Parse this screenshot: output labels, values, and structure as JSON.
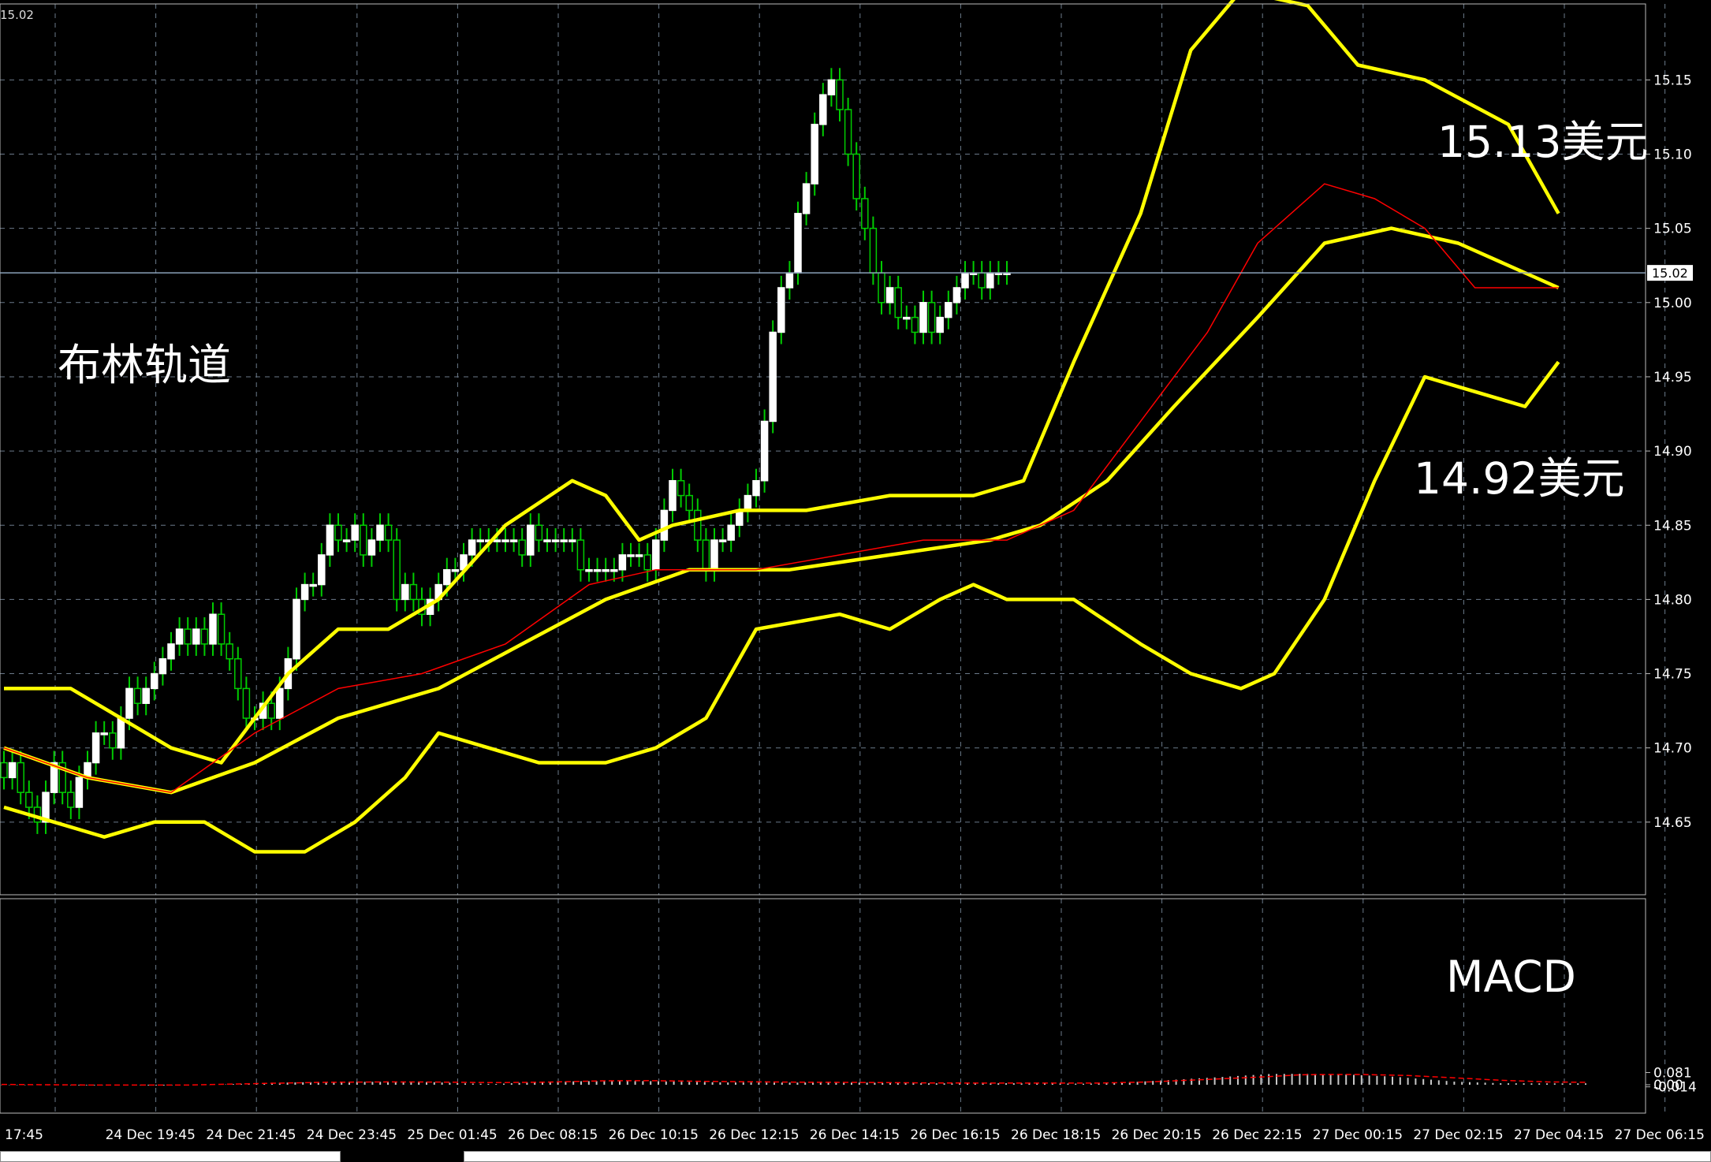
{
  "chart_data": [
    {
      "type": "candlestick",
      "price_readout_top_left": "15.02",
      "last_price": "15.02",
      "ylim": [
        14.605,
        15.205
      ],
      "y_ticks": [
        "15.15",
        "15.10",
        "15.05",
        "15.00",
        "14.95",
        "14.90",
        "14.85",
        "14.80",
        "14.75",
        "14.70",
        "14.65"
      ],
      "x_ticks": [
        "17:45",
        "24 Dec 19:45",
        "24 Dec 21:45",
        "24 Dec 23:45",
        "25 Dec 01:45",
        "26 Dec 08:15",
        "26 Dec 10:15",
        "26 Dec 12:15",
        "26 Dec 14:15",
        "26 Dec 16:15",
        "26 Dec 18:15",
        "26 Dec 20:15",
        "26 Dec 22:15",
        "27 Dec 00:15",
        "27 Dec 02:15",
        "27 Dec 04:15",
        "27 Dec 06:15"
      ],
      "annotations": [
        "布林轨道",
        "15.13美元",
        "14.92美元"
      ],
      "indicator": "Bollinger Bands",
      "colors": {
        "background": "#000000",
        "grid": "#6b7a8a",
        "candle_bull": "#ffffff",
        "wick": "#00cc00",
        "bands": "#ffff00",
        "signal": "#ff0000",
        "price_line": "#8aa0b8"
      },
      "bands": {
        "upper": [
          [
            0,
            14.74
          ],
          [
            8,
            14.74
          ],
          [
            20,
            14.7
          ],
          [
            26,
            14.69
          ],
          [
            30,
            14.72
          ],
          [
            34,
            14.75
          ],
          [
            40,
            14.78
          ],
          [
            46,
            14.78
          ],
          [
            52,
            14.8
          ],
          [
            60,
            14.85
          ],
          [
            68,
            14.88
          ],
          [
            72,
            14.87
          ],
          [
            76,
            14.84
          ],
          [
            80,
            14.85
          ],
          [
            88,
            14.86
          ],
          [
            96,
            14.86
          ],
          [
            106,
            14.87
          ],
          [
            116,
            14.87
          ],
          [
            122,
            14.88
          ],
          [
            128,
            14.96
          ],
          [
            136,
            15.06
          ],
          [
            142,
            15.17
          ],
          [
            148,
            15.21
          ],
          [
            156,
            15.2
          ],
          [
            162,
            15.16
          ],
          [
            170,
            15.15
          ],
          [
            180,
            15.12
          ],
          [
            186,
            15.06
          ]
        ],
        "middle": [
          [
            0,
            14.7
          ],
          [
            10,
            14.68
          ],
          [
            20,
            14.67
          ],
          [
            30,
            14.69
          ],
          [
            40,
            14.72
          ],
          [
            52,
            14.74
          ],
          [
            62,
            14.77
          ],
          [
            72,
            14.8
          ],
          [
            82,
            14.82
          ],
          [
            94,
            14.82
          ],
          [
            106,
            14.83
          ],
          [
            118,
            14.84
          ],
          [
            124,
            14.85
          ],
          [
            132,
            14.88
          ],
          [
            140,
            14.93
          ],
          [
            150,
            14.99
          ],
          [
            158,
            15.04
          ],
          [
            166,
            15.05
          ],
          [
            174,
            15.04
          ],
          [
            186,
            15.01
          ]
        ],
        "lower": [
          [
            0,
            14.66
          ],
          [
            6,
            14.65
          ],
          [
            12,
            14.64
          ],
          [
            18,
            14.65
          ],
          [
            24,
            14.65
          ],
          [
            30,
            14.63
          ],
          [
            36,
            14.63
          ],
          [
            42,
            14.65
          ],
          [
            48,
            14.68
          ],
          [
            52,
            14.71
          ],
          [
            58,
            14.7
          ],
          [
            64,
            14.69
          ],
          [
            72,
            14.69
          ],
          [
            78,
            14.7
          ],
          [
            84,
            14.72
          ],
          [
            90,
            14.78
          ],
          [
            100,
            14.79
          ],
          [
            106,
            14.78
          ],
          [
            112,
            14.8
          ],
          [
            116,
            14.81
          ],
          [
            120,
            14.8
          ],
          [
            128,
            14.8
          ],
          [
            136,
            14.77
          ],
          [
            142,
            14.75
          ],
          [
            148,
            14.74
          ],
          [
            152,
            14.75
          ],
          [
            158,
            14.8
          ],
          [
            164,
            14.88
          ],
          [
            170,
            14.95
          ],
          [
            176,
            14.94
          ],
          [
            182,
            14.93
          ],
          [
            186,
            14.96
          ]
        ]
      },
      "signal_ma": [
        [
          0,
          14.7
        ],
        [
          10,
          14.68
        ],
        [
          20,
          14.67
        ],
        [
          30,
          14.71
        ],
        [
          40,
          14.74
        ],
        [
          50,
          14.75
        ],
        [
          60,
          14.77
        ],
        [
          70,
          14.81
        ],
        [
          78,
          14.82
        ],
        [
          90,
          14.82
        ],
        [
          100,
          14.83
        ],
        [
          110,
          14.84
        ],
        [
          120,
          14.84
        ],
        [
          128,
          14.86
        ],
        [
          136,
          14.92
        ],
        [
          144,
          14.98
        ],
        [
          150,
          15.04
        ],
        [
          158,
          15.08
        ],
        [
          164,
          15.07
        ],
        [
          170,
          15.05
        ],
        [
          176,
          15.01
        ],
        [
          186,
          15.01
        ]
      ],
      "close": [
        14.68,
        14.69,
        14.67,
        14.66,
        14.65,
        14.67,
        14.69,
        14.67,
        14.66,
        14.68,
        14.69,
        14.71,
        14.71,
        14.7,
        14.72,
        14.74,
        14.73,
        14.74,
        14.75,
        14.76,
        14.77,
        14.78,
        14.77,
        14.78,
        14.77,
        14.79,
        14.77,
        14.76,
        14.74,
        14.72,
        14.72,
        14.73,
        14.72,
        14.74,
        14.76,
        14.8,
        14.81,
        14.81,
        14.83,
        14.85,
        14.84,
        14.84,
        14.85,
        14.83,
        14.84,
        14.85,
        14.84,
        14.8,
        14.81,
        14.8,
        14.79,
        14.8,
        14.81,
        14.82,
        14.82,
        14.83,
        14.84,
        14.84,
        14.84,
        14.84,
        14.84,
        14.84,
        14.83,
        14.85,
        14.84,
        14.84,
        14.84,
        14.84,
        14.84,
        14.82,
        14.82,
        14.82,
        14.82,
        14.82,
        14.83,
        14.83,
        14.83,
        14.82,
        14.84,
        14.86,
        14.88,
        14.87,
        14.86,
        14.84,
        14.82,
        14.84,
        14.84,
        14.85,
        14.86,
        14.87,
        14.88,
        14.92,
        14.98,
        15.01,
        15.02,
        15.06,
        15.08,
        15.12,
        15.14,
        15.15,
        15.13,
        15.1,
        15.07,
        15.05,
        15.02,
        15.0,
        15.01,
        14.99,
        14.99,
        14.98,
        15.0,
        14.98,
        14.99,
        15.0,
        15.01,
        15.02,
        15.02,
        15.01,
        15.02,
        15.02,
        15.02
      ]
    },
    {
      "type": "macd",
      "label": "MACD",
      "ylim": [
        -0.014,
        0.081
      ],
      "y_ticks": [
        "0.081",
        "0.00",
        "-0.014"
      ],
      "colors": {
        "histogram": "#c8c8c8",
        "signal": "#ff0000"
      },
      "histogram": [
        [
          0,
          -0.002
        ],
        [
          10,
          -0.004
        ],
        [
          16,
          -0.005
        ],
        [
          22,
          -0.005
        ],
        [
          27,
          -0.002
        ],
        [
          30,
          0.004
        ],
        [
          34,
          0.012
        ],
        [
          40,
          0.017
        ],
        [
          46,
          0.019
        ],
        [
          52,
          0.02
        ],
        [
          56,
          0.017
        ],
        [
          60,
          0.009
        ],
        [
          64,
          0.005
        ],
        [
          68,
          0.015
        ],
        [
          72,
          0.021
        ],
        [
          76,
          0.024
        ],
        [
          80,
          0.025
        ],
        [
          84,
          0.024
        ],
        [
          88,
          0.02
        ],
        [
          94,
          0.015
        ],
        [
          100,
          0.014
        ],
        [
          106,
          0.015
        ],
        [
          112,
          0.014
        ],
        [
          118,
          0.01
        ],
        [
          124,
          0.009
        ],
        [
          130,
          0.01
        ],
        [
          136,
          0.009
        ],
        [
          140,
          0.007
        ],
        [
          144,
          0.011
        ],
        [
          150,
          0.028
        ],
        [
          158,
          0.052
        ],
        [
          164,
          0.071
        ],
        [
          168,
          0.073
        ],
        [
          174,
          0.068
        ],
        [
          180,
          0.054
        ],
        [
          184,
          0.038
        ],
        [
          188,
          0.021
        ],
        [
          194,
          0.01
        ],
        [
          200,
          0.009
        ],
        [
          205,
          0.009
        ]
      ],
      "signal": [
        [
          0,
          0.002
        ],
        [
          12,
          -0.002
        ],
        [
          24,
          -0.002
        ],
        [
          34,
          0.009
        ],
        [
          42,
          0.016
        ],
        [
          50,
          0.019
        ],
        [
          56,
          0.018
        ],
        [
          64,
          0.014
        ],
        [
          70,
          0.017
        ],
        [
          78,
          0.026
        ],
        [
          84,
          0.027
        ],
        [
          90,
          0.023
        ],
        [
          96,
          0.02
        ],
        [
          104,
          0.017
        ],
        [
          112,
          0.015
        ],
        [
          120,
          0.012
        ],
        [
          128,
          0.011
        ],
        [
          136,
          0.011
        ],
        [
          142,
          0.011
        ],
        [
          148,
          0.018
        ],
        [
          156,
          0.035
        ],
        [
          164,
          0.054
        ],
        [
          168,
          0.066
        ],
        [
          172,
          0.068
        ],
        [
          176,
          0.068
        ],
        [
          182,
          0.061
        ],
        [
          188,
          0.046
        ],
        [
          194,
          0.03
        ],
        [
          200,
          0.019
        ],
        [
          205,
          0.016
        ]
      ]
    }
  ]
}
